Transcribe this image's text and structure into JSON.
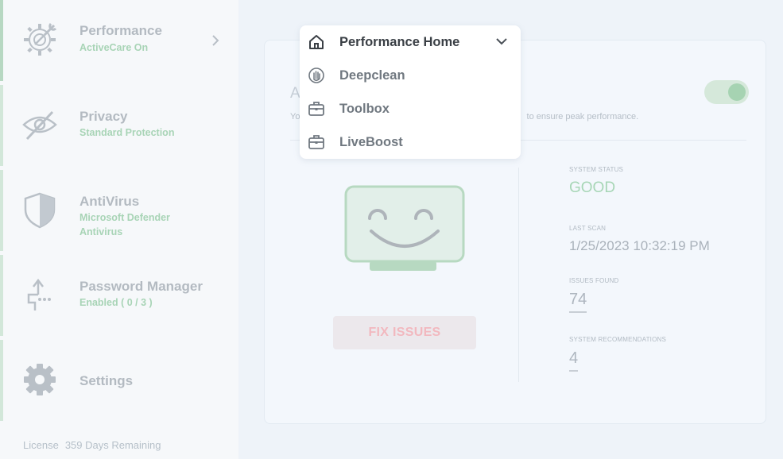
{
  "sidebar": {
    "items": [
      {
        "title": "Performance",
        "subtitle": "ActiveCare On",
        "icon": "gear-wrench-icon"
      },
      {
        "title": "Privacy",
        "subtitle": "Standard Protection",
        "icon": "eye-slash-icon"
      },
      {
        "title": "AntiVirus",
        "subtitle_line1": "Microsoft Defender",
        "subtitle_line2": "Antivirus",
        "icon": "shield-icon"
      },
      {
        "title": "Password Manager",
        "subtitle": "Enabled ( 0 / 3 )",
        "icon": "password-upload-icon"
      },
      {
        "title": "Settings",
        "icon": "gear-icon"
      }
    ],
    "license_label": "License",
    "license_value": "359 Days Remaining"
  },
  "card": {
    "title_partial": "A",
    "description_left": "Yo",
    "description_right": "to ensure peak performance.",
    "fix_button": "FIX ISSUES",
    "toggle_on": true
  },
  "stats": {
    "system_status_label": "SYSTEM STATUS",
    "system_status_value": "GOOD",
    "last_scan_label": "LAST SCAN",
    "last_scan_value": "1/25/2023 10:32:19 PM",
    "issues_found_label": "ISSUES FOUND",
    "issues_found_value": "74",
    "recommendations_label": "SYSTEM RECOMMENDATIONS",
    "recommendations_value": "4"
  },
  "dropdown": {
    "items": [
      {
        "label": "Performance Home",
        "icon": "home-icon"
      },
      {
        "label": "Deepclean",
        "icon": "hand-icon"
      },
      {
        "label": "Toolbox",
        "icon": "toolbox-icon"
      },
      {
        "label": "LiveBoost",
        "icon": "briefcase-icon"
      }
    ]
  },
  "colors": {
    "accent_green": "#a7d6b6",
    "fix_text": "#f2b8bf"
  }
}
